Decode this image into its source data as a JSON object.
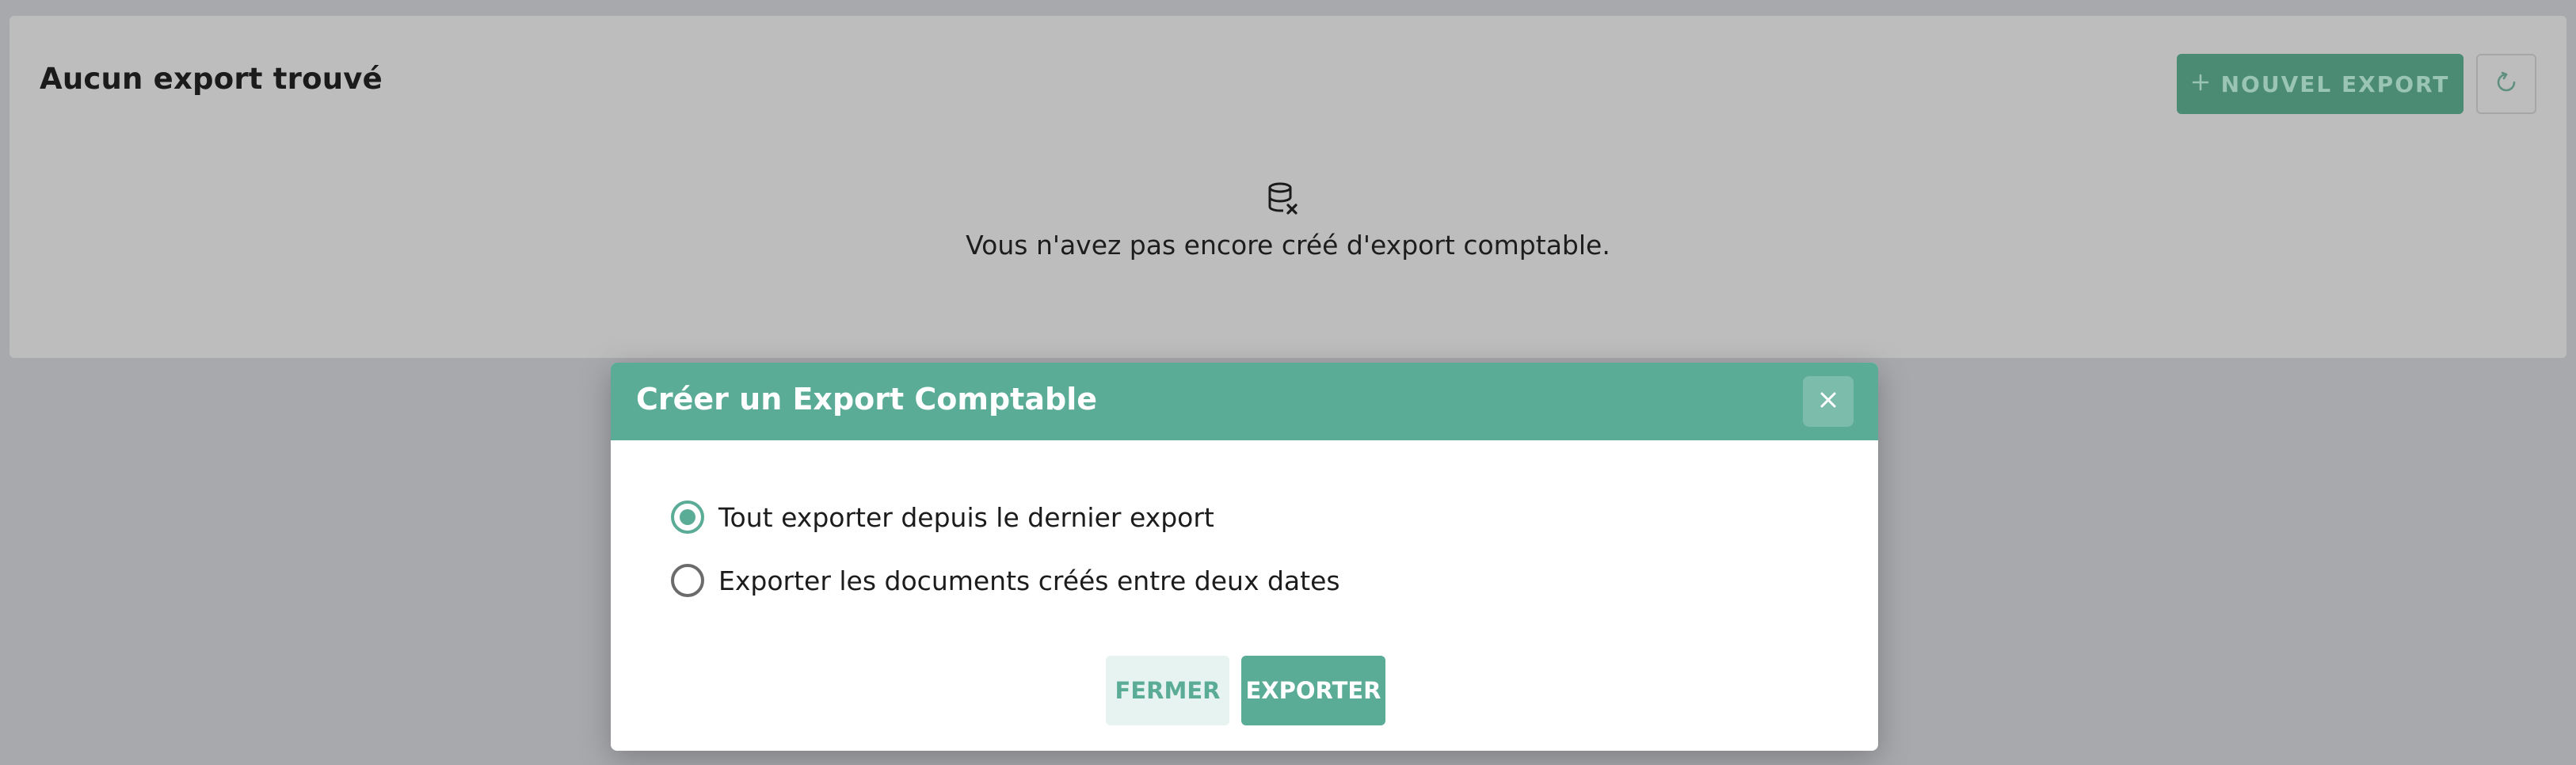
{
  "background": {
    "title": "Aucun export trouvé",
    "new_export_button": {
      "icon": "plus-icon",
      "label": "NOUVEL EXPORT"
    },
    "refresh_button": {
      "icon": "refresh-icon"
    },
    "empty_state": {
      "icon": "database-x-icon",
      "message": "Vous n'avez pas encore créé d'export comptable."
    }
  },
  "modal": {
    "title": "Créer un Export Comptable",
    "close_icon": "close-icon",
    "options": [
      {
        "label": "Tout exporter depuis le dernier export",
        "selected": true
      },
      {
        "label": "Exporter les documents créés entre deux dates",
        "selected": false
      }
    ],
    "buttons": {
      "close": "FERMER",
      "export": "EXPORTER"
    }
  },
  "colors": {
    "accent": "#5aac97",
    "accent_dim": "#4b8a73",
    "overlay": "#a8a9ad"
  }
}
